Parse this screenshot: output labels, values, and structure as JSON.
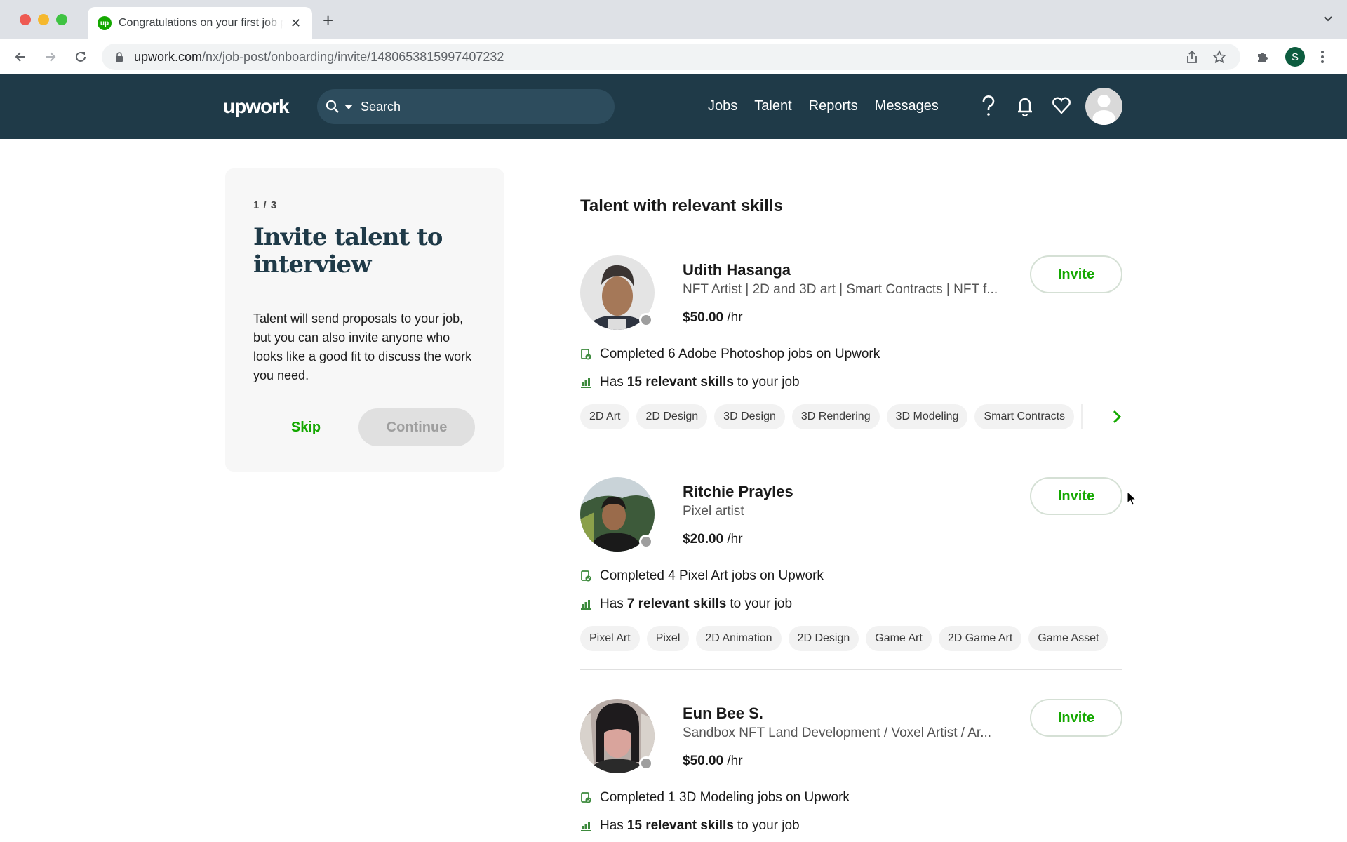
{
  "browser": {
    "tab_title": "Congratulations on your first job post",
    "favicon_text": "up",
    "url_host": "upwork.com",
    "url_path": "/nx/job-post/onboarding/invite/1480653815997407232",
    "profile_initial": "S"
  },
  "header": {
    "logo": "upwork",
    "search_placeholder": "Search",
    "nav": [
      "Jobs",
      "Talent",
      "Reports",
      "Messages"
    ]
  },
  "intro": {
    "step": "1 / 3",
    "title": "Invite talent to interview",
    "description": "Talent will send proposals to your job, but you can also invite anyone who looks like a good fit to discuss the work you need.",
    "skip_label": "Skip",
    "continue_label": "Continue"
  },
  "list": {
    "title": "Talent with relevant skills",
    "invite_label": "Invite",
    "talents": [
      {
        "name": "Udith Hasanga",
        "headline": "NFT Artist | 2D and 3D art | Smart Contracts | NFT f...",
        "rate": "$50.00",
        "rate_unit": "/hr",
        "completed": "Completed 6 Adobe Photoshop jobs on Upwork",
        "skills_prefix": "Has",
        "skills_count": "15 relevant skills",
        "skills_suffix": "to your job",
        "skills": [
          "2D Art",
          "2D Design",
          "3D Design",
          "3D Rendering",
          "3D Modeling",
          "Smart Contracts"
        ]
      },
      {
        "name": "Ritchie Prayles",
        "headline": "Pixel artist",
        "rate": "$20.00",
        "rate_unit": "/hr",
        "completed": "Completed 4 Pixel Art jobs on Upwork",
        "skills_prefix": "Has",
        "skills_count": "7 relevant skills",
        "skills_suffix": "to your job",
        "skills": [
          "Pixel Art",
          "Pixel",
          "2D Animation",
          "2D Design",
          "Game Art",
          "2D Game Art",
          "Game Asset"
        ]
      },
      {
        "name": "Eun Bee S.",
        "headline": "Sandbox NFT Land Development / Voxel Artist / Ar...",
        "rate": "$50.00",
        "rate_unit": "/hr",
        "completed": "Completed 1 3D Modeling jobs on Upwork",
        "skills_prefix": "Has",
        "skills_count": "15 relevant skills",
        "skills_suffix": "to your job",
        "skills": []
      }
    ]
  },
  "colors": {
    "brand_green": "#14a800",
    "header_bg": "#1f3a48",
    "status_offline": "#9e9e9e"
  }
}
